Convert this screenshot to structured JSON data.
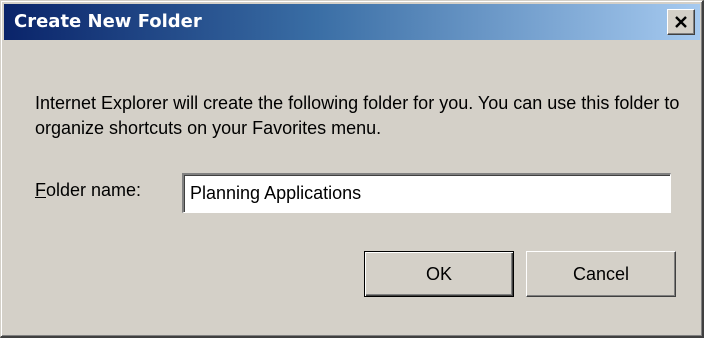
{
  "window": {
    "title": "Create New Folder",
    "close_icon": "close-x-icon"
  },
  "message": "Internet Explorer will create the following folder for you. You can use this folder to organize shortcuts on your Favorites menu.",
  "folder_field": {
    "label_accel": "F",
    "label_rest": "older name:",
    "value": "Planning Applications"
  },
  "buttons": {
    "ok_label": "OK",
    "cancel_label": "Cancel"
  },
  "colors": {
    "titlebar_start": "#0a246a",
    "titlebar_end": "#a6caf0",
    "face": "#d4d0c8"
  }
}
